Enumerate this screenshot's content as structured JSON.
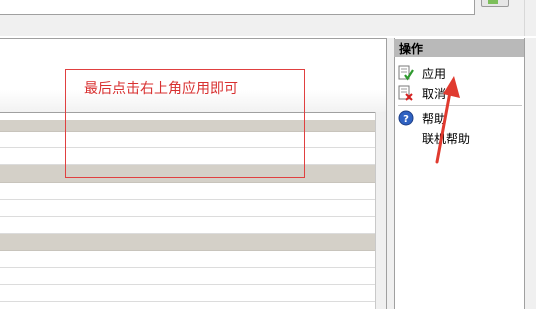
{
  "annotation": {
    "text": "最后点击右上角应用即可"
  },
  "actions": {
    "title": "操作",
    "items": [
      {
        "label": "应用",
        "icon": "apply-check-icon"
      },
      {
        "label": "取消",
        "icon": "cancel-x-icon"
      },
      {
        "label": "帮助",
        "icon": "help-icon"
      },
      {
        "label": "联机帮助",
        "icon": ""
      }
    ]
  },
  "colors": {
    "annotation": "#d83030",
    "arrow": "#e03a2f",
    "group_row": "#d4d0c8",
    "header_bar": "#b9b9b9"
  }
}
